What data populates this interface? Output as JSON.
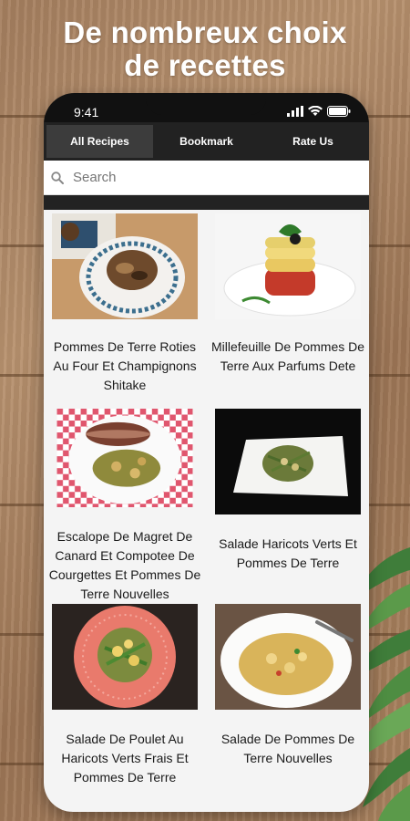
{
  "promo": {
    "headline_line1": "De nombreux choix",
    "headline_line2": "de recettes"
  },
  "status_bar": {
    "time": "9:41",
    "icons": [
      "signal-icon",
      "wifi-icon",
      "battery-icon"
    ]
  },
  "tabs": [
    {
      "label": "All Recipes",
      "active": true
    },
    {
      "label": "Bookmark",
      "active": false
    },
    {
      "label": "Rate Us",
      "active": false
    }
  ],
  "search": {
    "placeholder": "Search",
    "icon": "search-icon"
  },
  "recipes": [
    {
      "title": "Pommes De Terre Roties Au Four Et Champignons Shitake"
    },
    {
      "title": "Millefeuille De Pommes De Terre Aux Parfums Dete"
    },
    {
      "title": "Escalope De Magret De Canard Et Compotee De Courgettes Et Pommes De Terre Nouvelles"
    },
    {
      "title": "Salade Haricots Verts Et Pommes De Terre"
    },
    {
      "title": "Salade De Poulet Au Haricots Verts Frais Et Pommes De Terre"
    },
    {
      "title": "Salade De Pommes De Terre Nouvelles"
    }
  ],
  "colors": {
    "tab_bar": "#222222",
    "active_tab": "#3c3c3c",
    "screen_bg": "#f4f4f4"
  }
}
